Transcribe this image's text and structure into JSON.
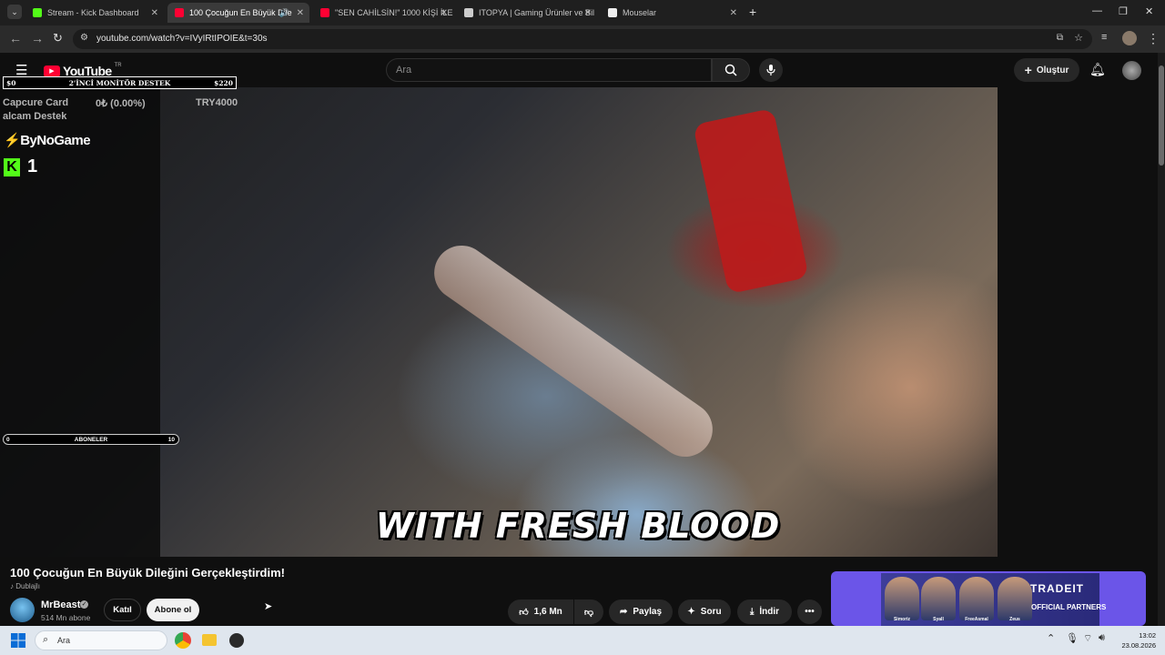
{
  "browser": {
    "tabs": [
      {
        "title": "Stream - Kick Dashboard",
        "favicon_color": "#53fc18"
      },
      {
        "title": "100 Çocuğun En Büyük Dile",
        "favicon_color": "#ff0033"
      },
      {
        "title": "\"SEN CAHİLSİN!\" 1000 KİŞİ İLE",
        "favicon_color": "#ff0033"
      },
      {
        "title": "ITOPYA | Gaming Ürünler ve Bil",
        "favicon_color": "#cccccc"
      },
      {
        "title": "Mouselar",
        "favicon_color": "#eeeeee"
      }
    ],
    "url": "youtube.com/watch?v=IVyIRtIPOIE&t=30s"
  },
  "youtube": {
    "logo_text": "YouTube",
    "region": "TR",
    "search_placeholder": "Ara",
    "create_label": "Oluştur"
  },
  "overlay": {
    "donation_left": "$0",
    "donation_title": "2'İNCİ MONİTÖR DESTEK",
    "donation_right": "$220",
    "capture_label": "Capcure Card",
    "capture_progress": "0₺ (0.00%)",
    "capture_goal": "TRY4000",
    "capture_sub": "alcam Destek",
    "sponsor": "ByNoGame",
    "kick_count": "1",
    "subs_left": "0",
    "subs_label": "ABONELER",
    "subs_right": "10"
  },
  "video": {
    "caption": "WITH FRESH BLOOD",
    "title": "100 Çocuğun En Büyük Dileğini Gerçekleştirdim!",
    "dub_label": "Dublajlı",
    "channel": "MrBeast",
    "subscribers": "514 Mn abone",
    "join_label": "Katıl",
    "subscribe_label": "Abone ol",
    "likes": "1,6 Mn",
    "share_label": "Paylaş",
    "ask_label": "Soru",
    "download_label": "İndir"
  },
  "ad": {
    "brand": "TRADEIT",
    "tagline": "OFFICIAL PARTNERS",
    "names": [
      "Simoriz",
      "Syall",
      "FreeAsmal",
      "Zeus"
    ]
  },
  "taskbar": {
    "search_placeholder": "Ara",
    "time": "13:02",
    "date": "23.08.2026"
  }
}
